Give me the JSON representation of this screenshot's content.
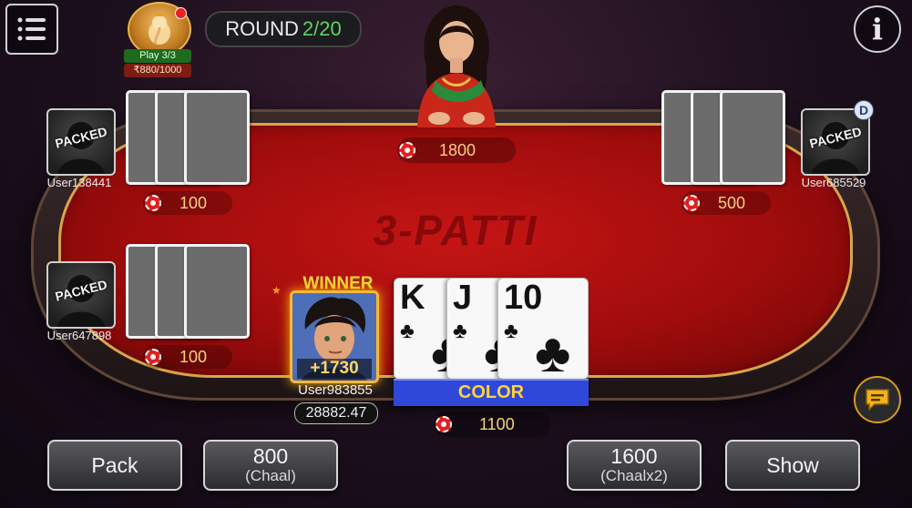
{
  "header": {
    "round_label": "ROUND",
    "round_value": "2/20",
    "info_icon": "i",
    "menu_icon": "hamburger-menu-icon"
  },
  "deity_badge": {
    "play_text": "Play 3/3",
    "amount_text": "₹880/1000"
  },
  "dealer": {
    "pot_amount": "1800"
  },
  "table": {
    "watermark": "3-PATTI"
  },
  "players": [
    {
      "name": "User138441",
      "status": "PACKED",
      "bet": "100"
    },
    {
      "name": "User647898",
      "status": "PACKED",
      "bet": "100"
    },
    {
      "name": "User685529",
      "status": "PACKED",
      "bet": "500",
      "dealer_marker": "D"
    }
  ],
  "winner": {
    "label": "WINNER",
    "amount": "+1730",
    "name": "User983855",
    "balance": "28882.47"
  },
  "hand": {
    "cards": [
      {
        "rank": "K",
        "suit": "♣"
      },
      {
        "rank": "J",
        "suit": "♣"
      },
      {
        "rank": "10",
        "suit": "♣"
      }
    ],
    "result": "COLOR",
    "pot": "1100"
  },
  "actions": {
    "pack": "Pack",
    "chaal_amount": "800",
    "chaal_label": "(Chaal)",
    "chaal2_amount": "1600",
    "chaal2_label": "(Chaalx2)",
    "show": "Show"
  },
  "colors": {
    "felt": "#b81010",
    "gold": "#f4b938",
    "color_bar": "#2f48d9",
    "round_green": "#5fd35f"
  }
}
